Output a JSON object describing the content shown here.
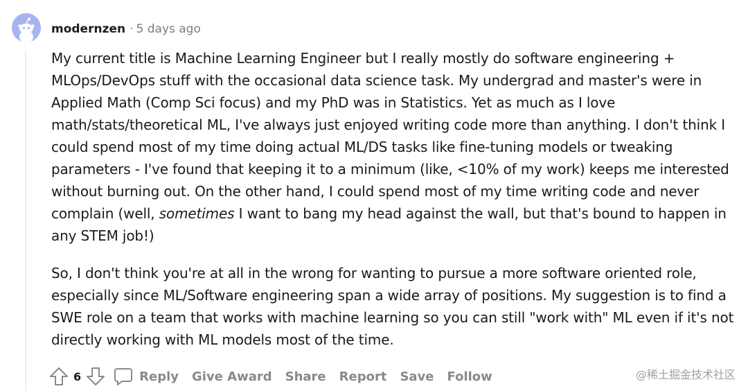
{
  "comment": {
    "username": "modernzen",
    "separator": "·",
    "timestamp": "5 days ago",
    "body": {
      "p1_before_italic": "My current title is Machine Learning Engineer but I really mostly do software engineering + MLOps/DevOps stuff with the occasional data science task. My undergrad and master's were in Applied Math (Comp Sci focus) and my PhD was in Statistics. Yet as much as I love math/stats/theoretical ML, I've always just enjoyed writing code more than anything. I don't think I could spend most of my time doing actual ML/DS tasks like fine-tuning models or tweaking parameters - I've found that keeping it to a minimum (like, <10% of my work) keeps me interested without burning out. On the other hand, I could spend most of my time writing code and never complain (well, ",
      "p1_italic": "sometimes",
      "p1_after_italic": " I want to bang my head against the wall, but that's bound to happen in any STEM job!)",
      "p2": "So, I don't think you're at all in the wrong for wanting to pursue a more software oriented role, especially since ML/Software engineering span a wide array of positions. My suggestion is to find a SWE role on a team that works with machine learning so you can still \"work with\" ML even if it's not directly working with ML models most of the time."
    },
    "score": "6",
    "actions": {
      "reply": "Reply",
      "give_award": "Give Award",
      "share": "Share",
      "report": "Report",
      "save": "Save",
      "follow": "Follow"
    },
    "icons": {
      "upvote": "upvote-arrow-icon",
      "downvote": "downvote-arrow-icon",
      "reply": "speech-bubble-icon",
      "avatar": "reddit-snoo-avatar"
    }
  },
  "watermark": "@稀土掘金技术社区",
  "colors": {
    "avatar_bg": "#a7b4f0",
    "action_text": "#878a8c",
    "body_text": "#1a1a1b"
  }
}
